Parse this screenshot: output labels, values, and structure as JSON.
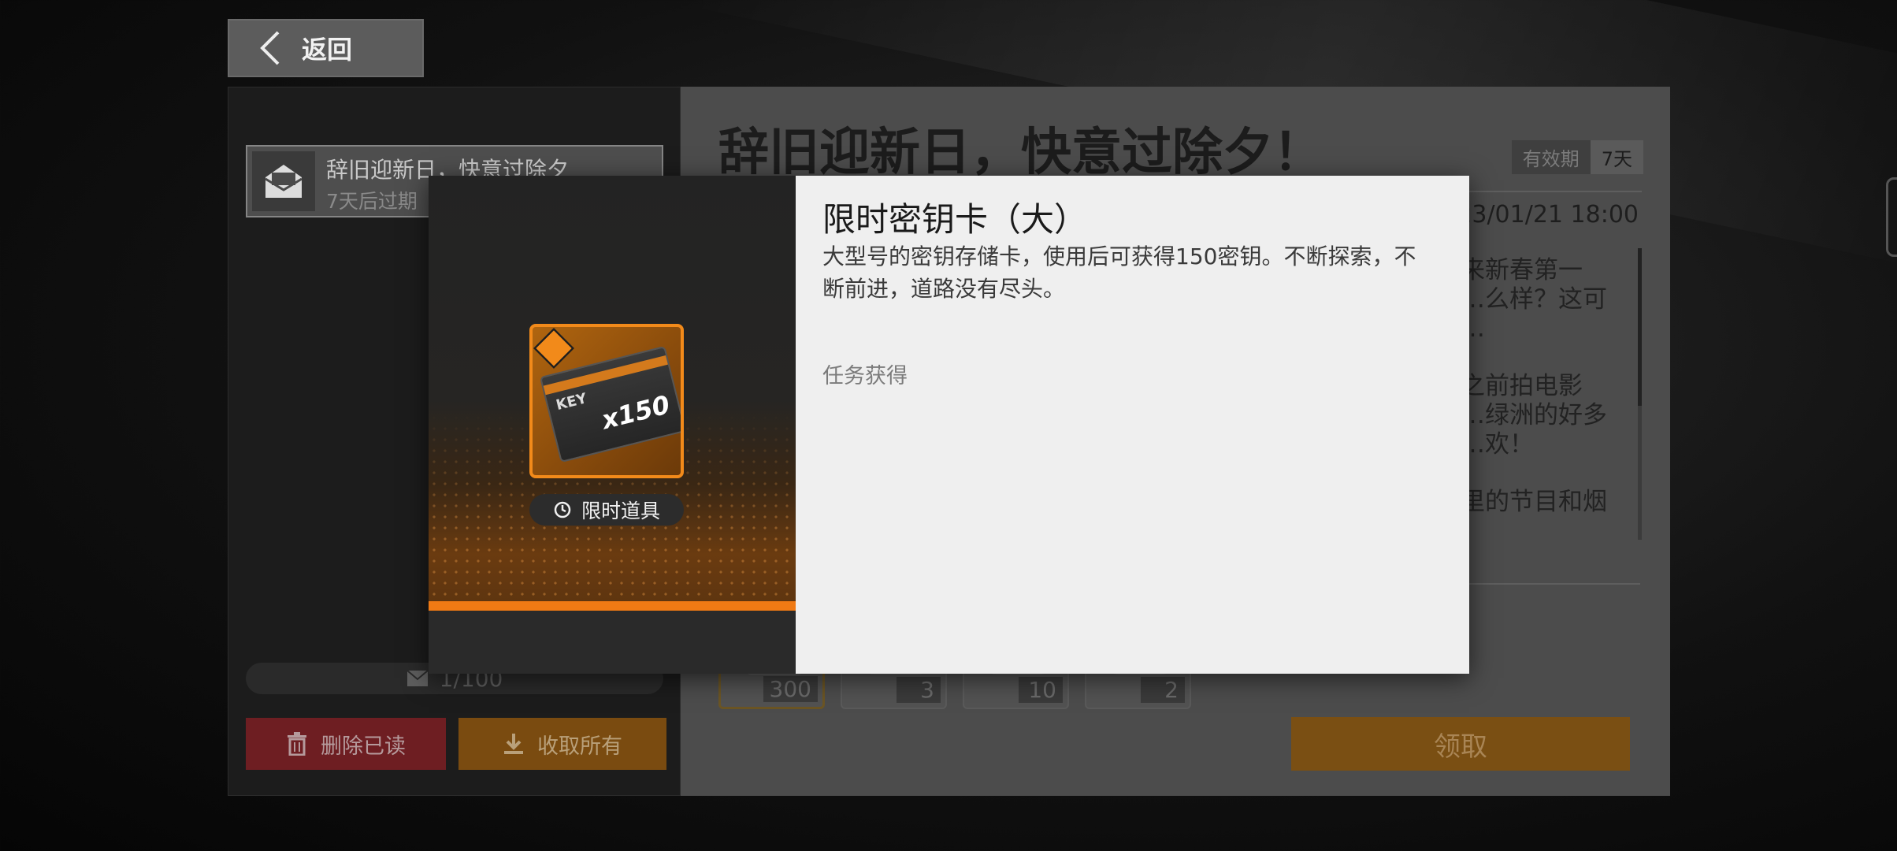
{
  "back": {
    "label": "返回"
  },
  "mail_list": {
    "items": [
      {
        "title": "辞旧迎新日，快意过除夕",
        "subtitle": "7天后过期"
      }
    ],
    "count": "1/100",
    "delete_read_label": "删除已读",
    "collect_all_label": "收取所有"
  },
  "mail": {
    "title": "辞旧迎新日，快意过除夕！",
    "validity_label": "有效期",
    "validity_value": "7天",
    "date": "2023/01/21 18:00",
    "paragraphs": [
      "……来新春第一份……么样？这可是……",
      "……之前拍电影的……绿洲的好多智……欢！",
      "……里的节目和烟"
    ],
    "rewards": [
      {
        "qty": "300"
      },
      {
        "qty": "3"
      },
      {
        "qty": "10"
      },
      {
        "qty": "2"
      }
    ],
    "claim_label": "领取"
  },
  "popup": {
    "item_name": "限时密钥卡（大）",
    "item_desc": "大型号的密钥存储卡，使用后可获得150密钥。不断探索，不断前进，道路没有尽头。",
    "source": "任务获得",
    "tag": "限时道具",
    "card_text": "KEY",
    "card_amount": "x150"
  },
  "colors": {
    "accent": "#f28a1a",
    "popup_bg": "#efefef",
    "delete_red": "#6e1e22",
    "collect_orange": "#7a4b10"
  }
}
